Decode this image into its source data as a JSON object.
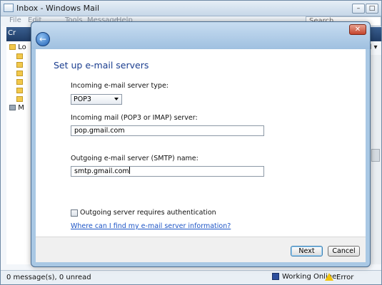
{
  "main_window": {
    "title": "Inbox - Windows Mail",
    "controls": {
      "minimize": "–",
      "maximize": "□"
    },
    "menu": [
      "File",
      "Edit",
      "Tools",
      "Message",
      "Help"
    ],
    "search_placeholder": "Search",
    "toolbar": {
      "create_label": "Cr",
      "dropdown_label": "d ▾"
    },
    "folder_tree": [
      "Lo",
      "M"
    ],
    "status": {
      "left": "0 message(s), 0 unread",
      "online": "Working Online",
      "error": "Error"
    }
  },
  "dialog": {
    "back_glyph": "←",
    "close_glyph": "✕",
    "heading": "Set up e-mail servers",
    "incoming_type": {
      "label": "Incoming e-mail server type:",
      "value": "POP3"
    },
    "incoming_server": {
      "label": "Incoming mail (POP3 or IMAP) server:",
      "value": "pop.gmail.com"
    },
    "outgoing_server": {
      "label": "Outgoing e-mail server (SMTP) name:",
      "value": "smtp.gmail.com"
    },
    "auth_checkbox_label": "Outgoing server requires authentication",
    "help_link": "Where can I find my e-mail server information?",
    "buttons": {
      "next": "Next",
      "cancel": "Cancel"
    }
  }
}
